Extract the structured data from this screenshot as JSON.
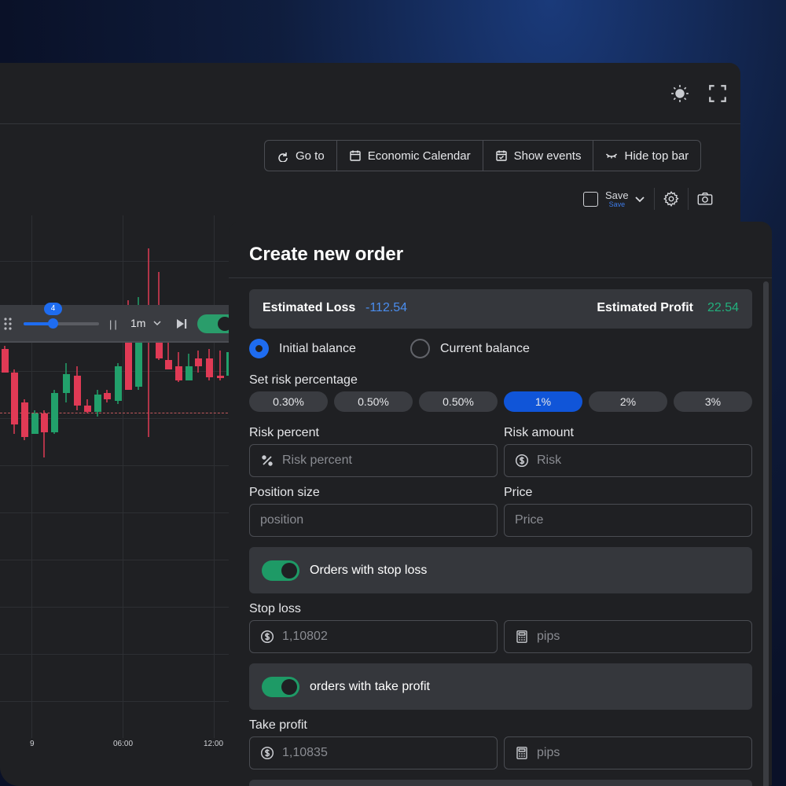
{
  "toolbar": {
    "goto": "Go to",
    "calendar": "Economic Calendar",
    "events": "Show events",
    "hide": "Hide top bar"
  },
  "save": {
    "label": "Save",
    "sublabel": "Save"
  },
  "playback": {
    "speed": "4",
    "timeframe": "1m",
    "slider_fraction": 0.4
  },
  "chart": {
    "x_ticks": [
      "9",
      "06:00",
      "12:00"
    ]
  },
  "order": {
    "title": "Create new order",
    "estimated_loss_label": "Estimated Loss",
    "estimated_loss_value": "-112.54",
    "estimated_profit_label": "Estimated Profit",
    "estimated_profit_value": "22.54",
    "balance_options": [
      "Initial balance",
      "Current balance"
    ],
    "balance_selected": "Initial balance",
    "risk_percentage_label": "Set risk percentage",
    "risk_chips": [
      "0.30%",
      "0.50%",
      "0.50%",
      "1%",
      "2%",
      "3%"
    ],
    "risk_chip_selected": "1%",
    "risk_percent_label": "Risk percent",
    "risk_percent_placeholder": "Risk percent",
    "risk_amount_label": "Risk amount",
    "risk_amount_placeholder": "Risk",
    "position_size_label": "Position size",
    "position_size_placeholder": "position",
    "price_label": "Price",
    "price_placeholder": "Price",
    "stop_loss_toggle_label": "Orders with stop loss",
    "stop_loss_label": "Stop loss",
    "stop_loss_value": "1,10802",
    "stop_loss_pips": "pips",
    "take_profit_toggle_label": "orders with take profit",
    "take_profit_label": "Take profit",
    "take_profit_value": "1,10835",
    "take_profit_pips": "pips"
  },
  "colors": {
    "accent": "#1e6cf0",
    "loss": "#4a8dee",
    "profit": "#22b07d",
    "toggle_on": "#1e9a66",
    "candle_up": "#22a06b",
    "candle_down": "#e03a55"
  }
}
